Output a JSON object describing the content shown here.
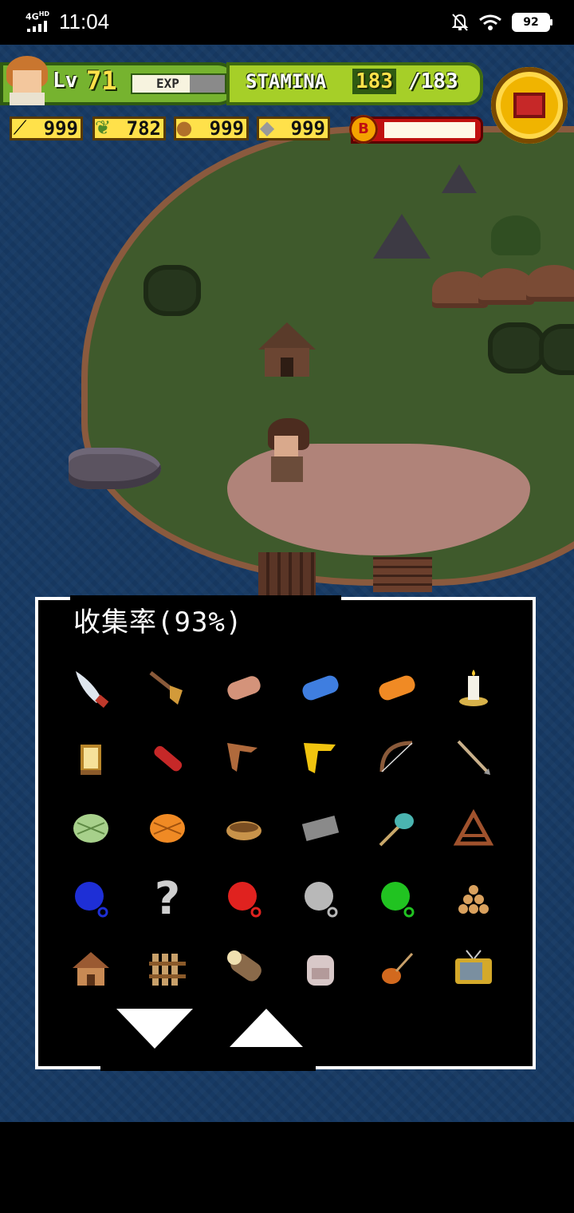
{
  "status_bar": {
    "network": "4G",
    "network_sup": "HD",
    "time": "11:04",
    "battery": "92"
  },
  "hud": {
    "level_label": "Lv",
    "level": "71",
    "exp_label": "EXP",
    "exp_fraction": 0.62,
    "stamina_label": "STAMINA",
    "stamina_current": "183",
    "stamina_max": "/183",
    "boss_label": "B",
    "resources": [
      {
        "name": "wood-sticks",
        "value": "999"
      },
      {
        "name": "leaves",
        "value": "782"
      },
      {
        "name": "nuts",
        "value": "999"
      },
      {
        "name": "stone",
        "value": "999"
      }
    ]
  },
  "panel": {
    "title": "收集率(93%)",
    "items": [
      {
        "name": "knife-icon"
      },
      {
        "name": "hand-drill-icon"
      },
      {
        "name": "log-icon"
      },
      {
        "name": "blue-fabric-icon"
      },
      {
        "name": "orange-fabric-icon"
      },
      {
        "name": "candle-icon"
      },
      {
        "name": "lantern-icon"
      },
      {
        "name": "flashlight-icon"
      },
      {
        "name": "boomerang-icon"
      },
      {
        "name": "banana-boomerang-icon"
      },
      {
        "name": "bow-icon"
      },
      {
        "name": "arrow-icon"
      },
      {
        "name": "green-net-icon"
      },
      {
        "name": "orange-net-icon"
      },
      {
        "name": "basket-icon"
      },
      {
        "name": "stone-block-icon"
      },
      {
        "name": "bug-net-icon"
      },
      {
        "name": "trap-icon"
      },
      {
        "name": "blue-ball-icon"
      },
      {
        "name": "unknown-item-icon",
        "label": "?"
      },
      {
        "name": "red-ball-icon"
      },
      {
        "name": "gray-ball-icon"
      },
      {
        "name": "green-ball-icon"
      },
      {
        "name": "firewood-stack-icon"
      },
      {
        "name": "house-icon"
      },
      {
        "name": "wood-fence-icon"
      },
      {
        "name": "wood-log-icon"
      },
      {
        "name": "backpack-icon"
      },
      {
        "name": "violin-icon"
      },
      {
        "name": "television-icon"
      }
    ]
  }
}
